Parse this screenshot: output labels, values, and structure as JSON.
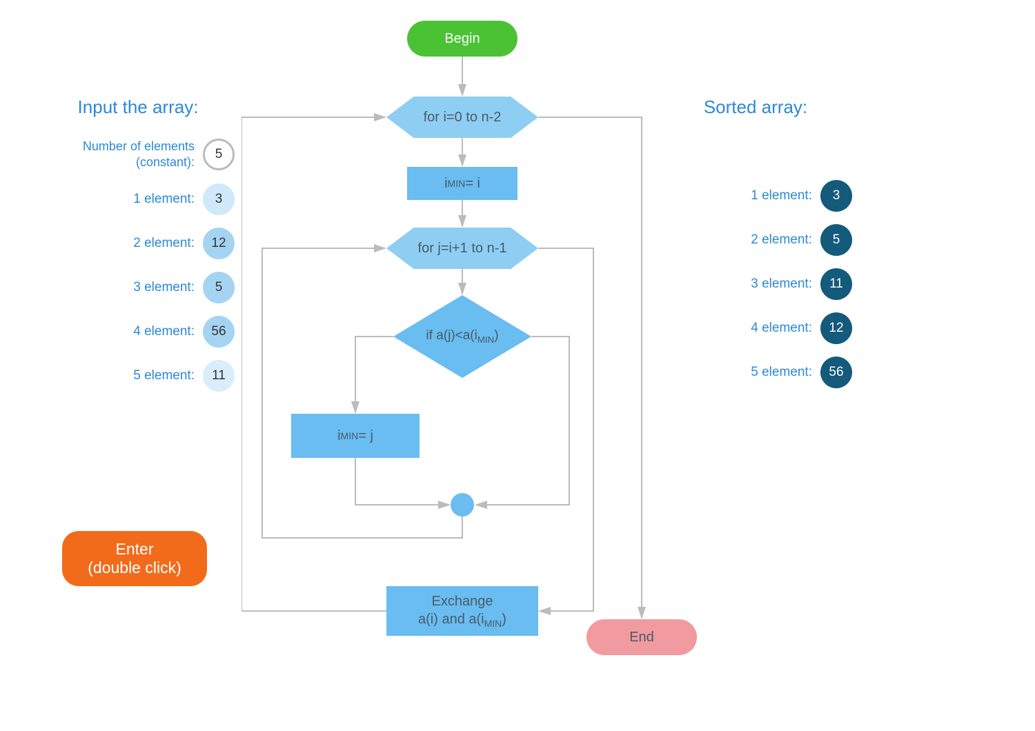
{
  "input": {
    "title": "Input the array:",
    "num_label_line1": "Number of elements",
    "num_label_line2": "(constant):",
    "num_value": "5",
    "elements": [
      {
        "label": "1 element:",
        "value": "3"
      },
      {
        "label": "2 element:",
        "value": "12"
      },
      {
        "label": "3 element:",
        "value": "5"
      },
      {
        "label": "4 element:",
        "value": "56"
      },
      {
        "label": "5 element:",
        "value": "11"
      }
    ]
  },
  "enter": {
    "line1": "Enter",
    "line2": "(double click)"
  },
  "output": {
    "title": "Sorted array:",
    "elements": [
      {
        "label": "1 element:",
        "value": "3"
      },
      {
        "label": "2 element:",
        "value": "5"
      },
      {
        "label": "3 element:",
        "value": "11"
      },
      {
        "label": "4 element:",
        "value": "12"
      },
      {
        "label": "5 element:",
        "value": "56"
      }
    ]
  },
  "flow": {
    "begin": "Begin",
    "loop_i": "for i=0 to n-2",
    "set_min_i_main": "i",
    "set_min_i_sub": "MIN",
    "set_min_i_suffix": " = i",
    "loop_j": "for j=i+1 to n-1",
    "cond_prefix": "if a(j)<a(i",
    "cond_sub": "MIN",
    "cond_suffix": ")",
    "set_min_j_main": "i",
    "set_min_j_sub": "MIN",
    "set_min_j_suffix": " = j",
    "exchange_l1": "Exchange",
    "exchange_l2_prefix": "a(i) and a(i",
    "exchange_l2_sub": "MIN",
    "exchange_l2_suffix": ")",
    "end": "End"
  }
}
